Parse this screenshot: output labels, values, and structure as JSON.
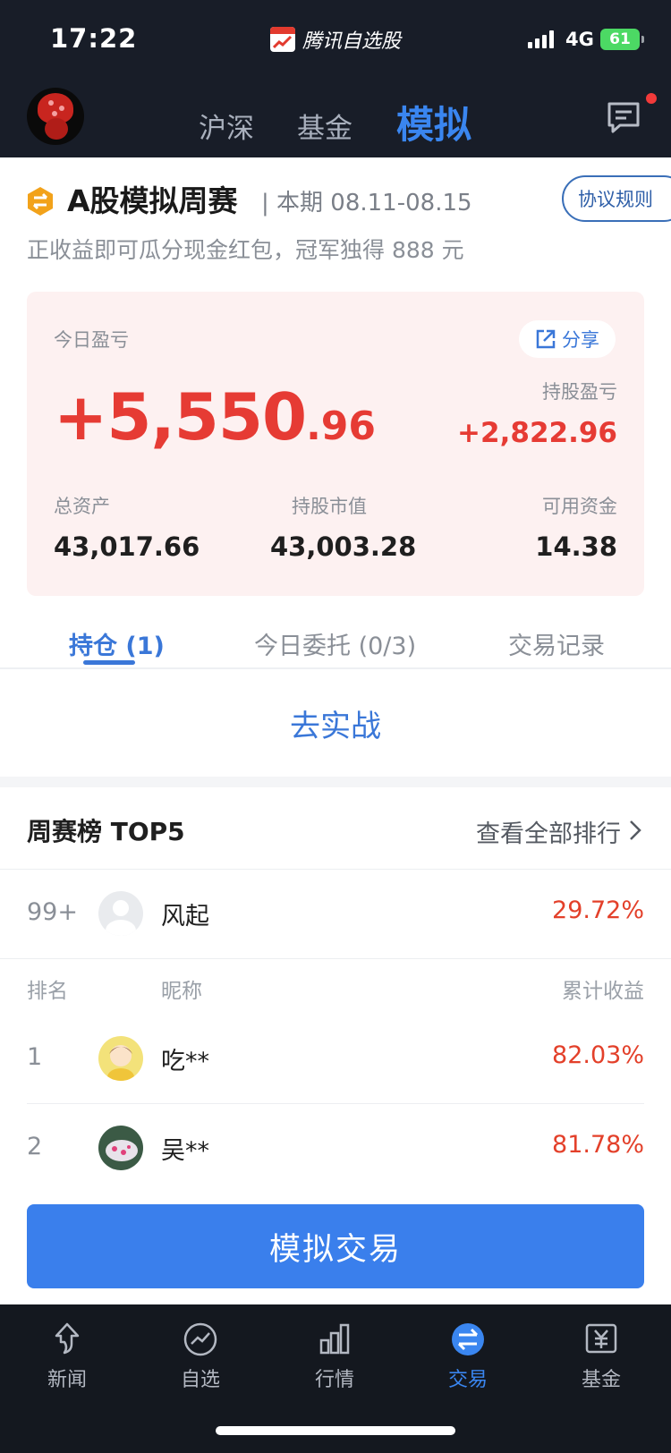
{
  "status_bar": {
    "time": "17:22",
    "app_name": "腾讯自选股",
    "network": "4G",
    "battery": "61"
  },
  "header": {
    "tabs": [
      {
        "label": "沪深",
        "active": false
      },
      {
        "label": "基金",
        "active": false
      },
      {
        "label": "模拟",
        "active": true
      }
    ],
    "has_unread_message": true
  },
  "contest": {
    "title": "A股模拟周赛",
    "period": "| 本期 08.11-08.15",
    "rules_button": "协议规则",
    "description": "正收益即可瓜分现金红包，冠军独得 888 元"
  },
  "pnl_card": {
    "today_label": "今日盈亏",
    "share_label": "分享",
    "today_int": "+5,550",
    "today_dec": ".96",
    "holding_pnl_label": "持股盈亏",
    "holding_pnl_value": "+2,822.96",
    "total_assets_label": "总资产",
    "total_assets_value": "43,017.66",
    "market_value_label": "持股市值",
    "market_value_value": "43,003.28",
    "available_label": "可用资金",
    "available_value": "14.38"
  },
  "tabs": [
    {
      "label": "持仓 (1)",
      "active": true
    },
    {
      "label": "今日委托 (0/3)",
      "active": false
    },
    {
      "label": "交易记录",
      "active": false
    }
  ],
  "go_real_label": "去实战",
  "leaderboard": {
    "title": "周赛榜 TOP5",
    "view_all": "查看全部排行",
    "me": {
      "rank": "99+",
      "nickname": "风起",
      "return": "29.72%"
    },
    "columns": {
      "rank": "排名",
      "nickname": "昵称",
      "return": "累计收益"
    },
    "rows": [
      {
        "rank": "1",
        "nickname": "吃**",
        "return": "82.03%"
      },
      {
        "rank": "2",
        "nickname": "吴**",
        "return": "81.78%"
      }
    ]
  },
  "sim_trade_button": "模拟交易",
  "bottom_nav": [
    {
      "label": "新闻",
      "icon": "news-icon",
      "active": false
    },
    {
      "label": "自选",
      "icon": "watchlist-icon",
      "active": false
    },
    {
      "label": "行情",
      "icon": "market-icon",
      "active": false
    },
    {
      "label": "交易",
      "icon": "trade-icon",
      "active": true
    },
    {
      "label": "基金",
      "icon": "fund-icon",
      "active": false
    }
  ],
  "colors": {
    "accent": "#3a7fec",
    "profit_red": "#e63b34",
    "header_bg": "#181d28",
    "card_bg": "#fdf1f1"
  }
}
